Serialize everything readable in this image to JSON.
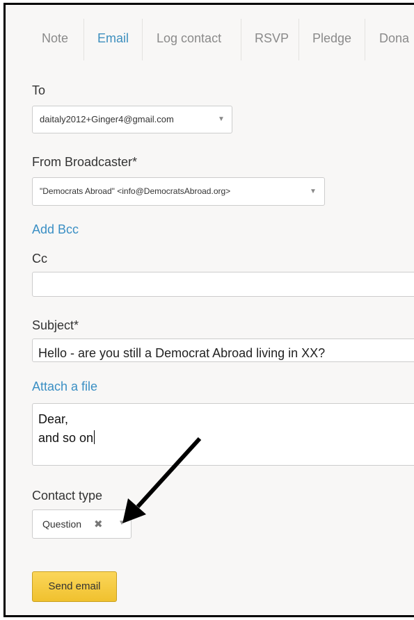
{
  "tabs": [
    {
      "label": "Note"
    },
    {
      "label": "Email"
    },
    {
      "label": "Log contact"
    },
    {
      "label": "RSVP"
    },
    {
      "label": "Pledge"
    },
    {
      "label": "Dona"
    }
  ],
  "active_tab": "Email",
  "form": {
    "to_label": "To",
    "to_value": "daitaly2012+Ginger4@gmail.com",
    "from_label": "From Broadcaster*",
    "from_value": "\"Democrats Abroad\" <info@DemocratsAbroad.org>",
    "add_bcc_link": "Add Bcc",
    "cc_label": "Cc",
    "cc_value": "",
    "subject_label": "Subject*",
    "subject_value": "Hello - are you still a Democrat Abroad living in XX?",
    "attach_link": "Attach a file",
    "body_lines": [
      "Dear,",
      "and so on"
    ],
    "contact_type_label": "Contact type",
    "contact_type_value": "Question",
    "send_button": "Send email"
  },
  "icons": {
    "dropdown": "caret-down-icon",
    "remove": "close-icon",
    "annotation": "arrow-icon"
  },
  "colors": {
    "link": "#3a8fc4",
    "active_tab": "#3d8fbe",
    "send_button": "#f0c12e",
    "background": "#f8f7f6"
  }
}
